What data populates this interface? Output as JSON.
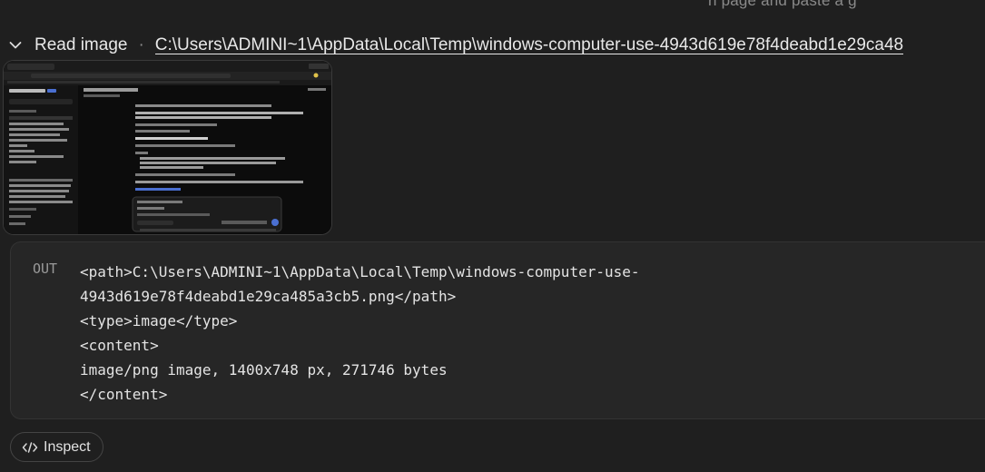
{
  "top_fragment": "n page and paste a g",
  "read": {
    "label": "Read image",
    "separator": "·",
    "path": "C:\\Users\\ADMINI~1\\AppData\\Local\\Temp\\windows-computer-use-4943d619e78f4deabd1e29ca48"
  },
  "output": {
    "label": "OUT",
    "lines": [
      "<path>C:\\Users\\ADMINI~1\\AppData\\Local\\Temp\\windows-computer-use-",
      "4943d619e78f4deabd1e29ca485a3cb5.png</path>",
      "<type>image</type>",
      "<content>",
      "image/png image, 1400x748 px, 271746 bytes",
      "</content>"
    ]
  },
  "inspect": {
    "icon": "code-icon",
    "label": "Inspect"
  },
  "colors": {
    "background": "#1f1f1f",
    "panel": "#262626",
    "border": "#333333",
    "text": "#e6e6e6",
    "muted": "#9a9a9a"
  }
}
